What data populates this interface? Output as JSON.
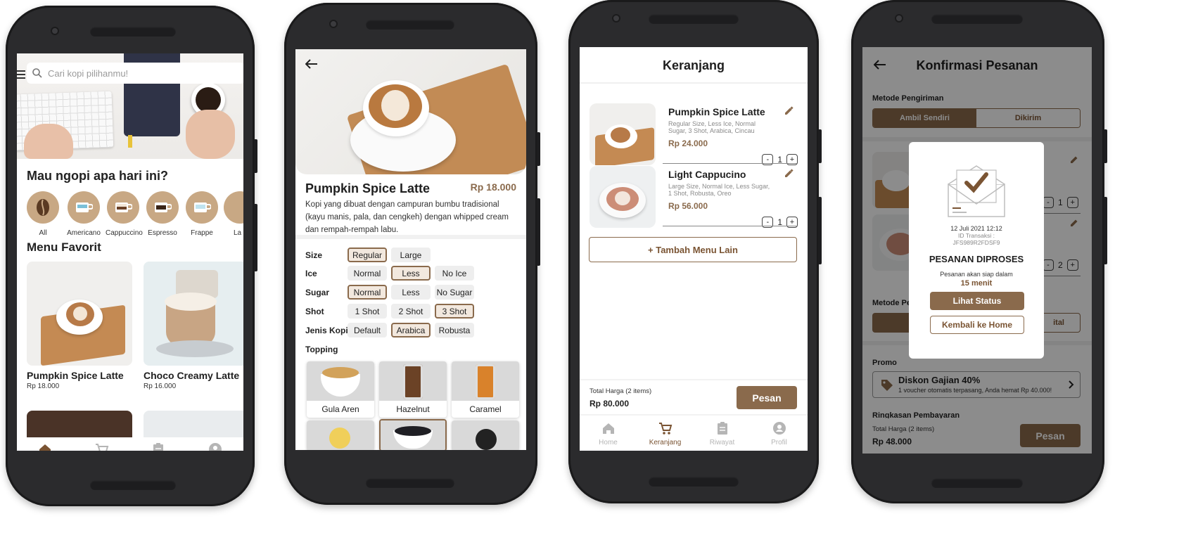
{
  "colors": {
    "accent": "#8a6a4c",
    "accent_text": "#7a5433",
    "inactive": "#b5b5b5"
  },
  "screen1": {
    "search_placeholder": "Cari kopi pilihanmu!",
    "heading": "Mau ngopi apa hari ini?",
    "categories": [
      "All",
      "Americano",
      "Cappuccino",
      "Espresso",
      "Frappe",
      "La"
    ],
    "favorites_heading": "Menu Favorit",
    "favorites": [
      {
        "name": "Pumpkin Spice Latte",
        "price": "Rp 18.000"
      },
      {
        "name": "Choco Creamy Latte",
        "price": "Rp 16.000"
      }
    ]
  },
  "nav": {
    "home": "Home",
    "cart": "Keranjang",
    "history": "Riwayat",
    "profile": "Profil"
  },
  "screen2": {
    "product_name": "Pumpkin Spice Latte",
    "price": "Rp 18.000",
    "description": "Kopi yang dibuat dengan campuran bumbu tradisional (kayu manis, pala, dan cengkeh) dengan whipped cream dan rempah-rempah labu.",
    "options": [
      {
        "label": "Size",
        "choices": [
          "Regular",
          "Large"
        ],
        "selected": 0
      },
      {
        "label": "Ice",
        "choices": [
          "Normal",
          "Less",
          "No Ice"
        ],
        "selected": 1
      },
      {
        "label": "Sugar",
        "choices": [
          "Normal",
          "Less",
          "No Sugar"
        ],
        "selected": 0
      },
      {
        "label": "Shot",
        "choices": [
          "1 Shot",
          "2 Shot",
          "3 Shot"
        ],
        "selected": 2
      },
      {
        "label": "Jenis Kopi",
        "choices": [
          "Default",
          "Arabica",
          "Robusta"
        ],
        "selected": 1
      }
    ],
    "topping_heading": "Topping",
    "toppings": [
      "Gula Aren",
      "Hazelnut",
      "Caramel"
    ]
  },
  "screen3": {
    "title": "Keranjang",
    "items": [
      {
        "name": "Pumpkin Spice Latte",
        "desc": "Regular Size, Less Ice, Normal Sugar, 3 Shot, Arabica, Cincau",
        "price": "Rp 24.000",
        "qty": "1"
      },
      {
        "name": "Light Cappucino",
        "desc": "Large Size, Normal  Ice, Less Sugar, 1 Shot, Robusta, Oreo",
        "price": "Rp 56.000",
        "qty": "1"
      }
    ],
    "add_more": "+ Tambah Menu Lain",
    "total_label": "Total Harga (2 items)",
    "total_value": "Rp 80.000",
    "order_button": "Pesan"
  },
  "screen4": {
    "title": "Konfirmasi Pesanan",
    "delivery_label": "Metode Pengiriman",
    "delivery_options": [
      "Ambil Sendiri",
      "Dikirim"
    ],
    "payment_label_partial": "Metode Pe",
    "payment_partial": "ital",
    "qty_1": "1",
    "qty_2": "2",
    "promo_label": "Promo",
    "promo_title": "Diskon Gajian 40%",
    "promo_desc": "1 voucher otomatis terpasang, Anda hemat Rp 40.000!",
    "summary_label": "Ringkasan Pembayaran",
    "total_label": "Total Harga (2 items)",
    "total_value": "Rp 48.000",
    "order_button": "Pesan",
    "modal": {
      "datetime": "12 Juli 2021 12:12",
      "trx_label": "ID Transaksi :",
      "trx_id": "JFS989R2FDSF9",
      "status": "PESANAN DIPROSES",
      "ready_text": "Pesanan akan siap dalam",
      "ready_time": "15 menit",
      "status_button": "Lihat Status",
      "home_button": "Kembali ke Home"
    }
  }
}
